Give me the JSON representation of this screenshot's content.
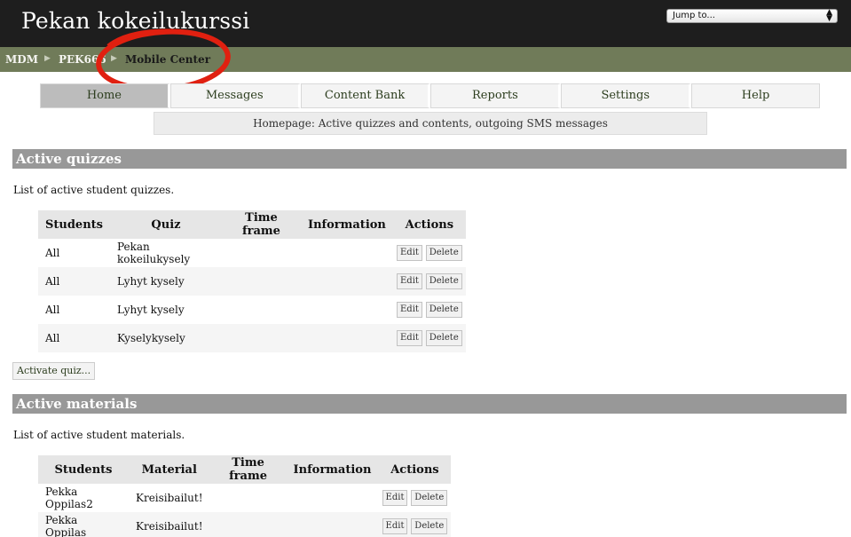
{
  "header": {
    "site_title": "Pekan kokeilukurssi",
    "jump_placeholder": "Jump to..."
  },
  "breadcrumb": {
    "items": [
      "MDM",
      "PEK666",
      "Mobile Center"
    ]
  },
  "nav": {
    "tabs": [
      {
        "label": "Home",
        "active": true
      },
      {
        "label": "Messages",
        "active": false
      },
      {
        "label": "Content Bank",
        "active": false
      },
      {
        "label": "Reports",
        "active": false
      },
      {
        "label": "Settings",
        "active": false
      },
      {
        "label": "Help",
        "active": false
      }
    ],
    "subtitle": "Homepage: Active quizzes and contents, outgoing SMS messages"
  },
  "quizzes": {
    "heading": "Active quizzes",
    "description": "List of active student quizzes.",
    "columns": [
      "Students",
      "Quiz",
      "Time frame",
      "Information",
      "Actions"
    ],
    "rows": [
      {
        "students": "All",
        "quiz": "Pekan kokeilukysely",
        "timeframe": "",
        "information": ""
      },
      {
        "students": "All",
        "quiz": "Lyhyt kysely",
        "timeframe": "",
        "information": ""
      },
      {
        "students": "All",
        "quiz": "Lyhyt kysely",
        "timeframe": "",
        "information": ""
      },
      {
        "students": "All",
        "quiz": "Kyselykysely",
        "timeframe": "",
        "information": ""
      }
    ],
    "activate_label": "Activate quiz..."
  },
  "materials": {
    "heading": "Active materials",
    "description": "List of active student materials.",
    "columns": [
      "Students",
      "Material",
      "Time frame",
      "Information",
      "Actions"
    ],
    "rows": [
      {
        "students": "Pekka Oppilas2",
        "material": "Kreisibailut!",
        "timeframe": "",
        "information": ""
      },
      {
        "students": "Pekka Oppilas",
        "material": "Kreisibailut!",
        "timeframe": "",
        "information": ""
      }
    ]
  },
  "actions": {
    "edit": "Edit",
    "delete": "Delete"
  },
  "colors": {
    "header_bg": "#1e1e1e",
    "breadcrumb_bg": "#707b59",
    "section_heading_bg": "#989898",
    "annotation_ring": "#e02010"
  }
}
